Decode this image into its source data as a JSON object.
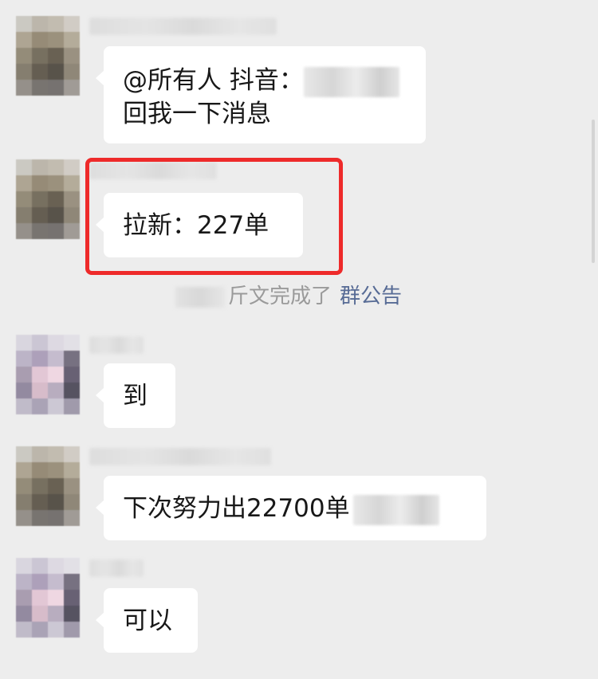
{
  "colors": {
    "background": "#ededed",
    "bubble": "#ffffff",
    "text": "#181818",
    "system_text": "#9a9a9a",
    "link": "#576b95",
    "highlight": "#ee2a2a"
  },
  "messages": [
    {
      "avatar_icon": "pixelated-avatar-icon-a",
      "lines": [
        "@所有人 抖音：",
        "回我一下消息"
      ]
    },
    {
      "avatar_icon": "pixelated-avatar-icon-a",
      "lines": [
        "拉新：227单"
      ],
      "highlighted": true
    },
    {
      "avatar_icon": "pixelated-avatar-icon-b",
      "lines": [
        "到"
      ]
    },
    {
      "avatar_icon": "pixelated-avatar-icon-a",
      "lines": [
        "下次努力出22700单"
      ]
    },
    {
      "avatar_icon": "pixelated-avatar-icon-b",
      "lines": [
        "可以"
      ]
    }
  ],
  "system_notice": {
    "text": "斤文完成了",
    "link": "群公告"
  }
}
